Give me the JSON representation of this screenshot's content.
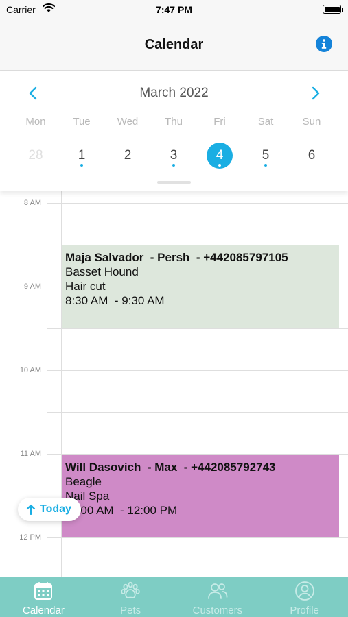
{
  "status_bar": {
    "carrier": "Carrier",
    "time": "7:47 PM"
  },
  "nav": {
    "title": "Calendar",
    "info_icon": "info-icon"
  },
  "calendar": {
    "month_title": "March 2022",
    "accent_color": "#1aaee3",
    "days": [
      {
        "name": "Mon",
        "number": "28",
        "muted": true,
        "has_event": false
      },
      {
        "name": "Tue",
        "number": "1",
        "muted": false,
        "has_event": true
      },
      {
        "name": "Wed",
        "number": "2",
        "muted": false,
        "has_event": false
      },
      {
        "name": "Thu",
        "number": "3",
        "muted": false,
        "has_event": true
      },
      {
        "name": "Fri",
        "number": "4",
        "muted": false,
        "has_event": true,
        "selected": true
      },
      {
        "name": "Sat",
        "number": "5",
        "muted": false,
        "has_event": true
      },
      {
        "name": "Sun",
        "number": "6",
        "muted": false,
        "has_event": false
      }
    ]
  },
  "timeline": {
    "hours": [
      "8 AM",
      "9 AM",
      "10 AM",
      "11 AM",
      "12 PM"
    ],
    "events": [
      {
        "title": "Maja Salvador  - Persh  - +442085797105",
        "breed": "Basset Hound",
        "service": "Hair cut",
        "time": "8:30 AM  - 9:30 AM",
        "color": "#dde7dc"
      },
      {
        "title": "Will Dasovich  - Max  - +442085792743",
        "breed": "Beagle",
        "service": "Nail Spa",
        "time": "11:00 AM  - 12:00 PM",
        "color": "#cf8ac7"
      }
    ],
    "today_button": "Today"
  },
  "tabs": [
    {
      "label": "Calendar",
      "icon": "calendar-icon",
      "active": true
    },
    {
      "label": "Pets",
      "icon": "paw-icon",
      "active": false
    },
    {
      "label": "Customers",
      "icon": "customers-icon",
      "active": false
    },
    {
      "label": "Profile",
      "icon": "profile-icon",
      "active": false
    }
  ],
  "tab_bar_color": "#7ecdc4"
}
